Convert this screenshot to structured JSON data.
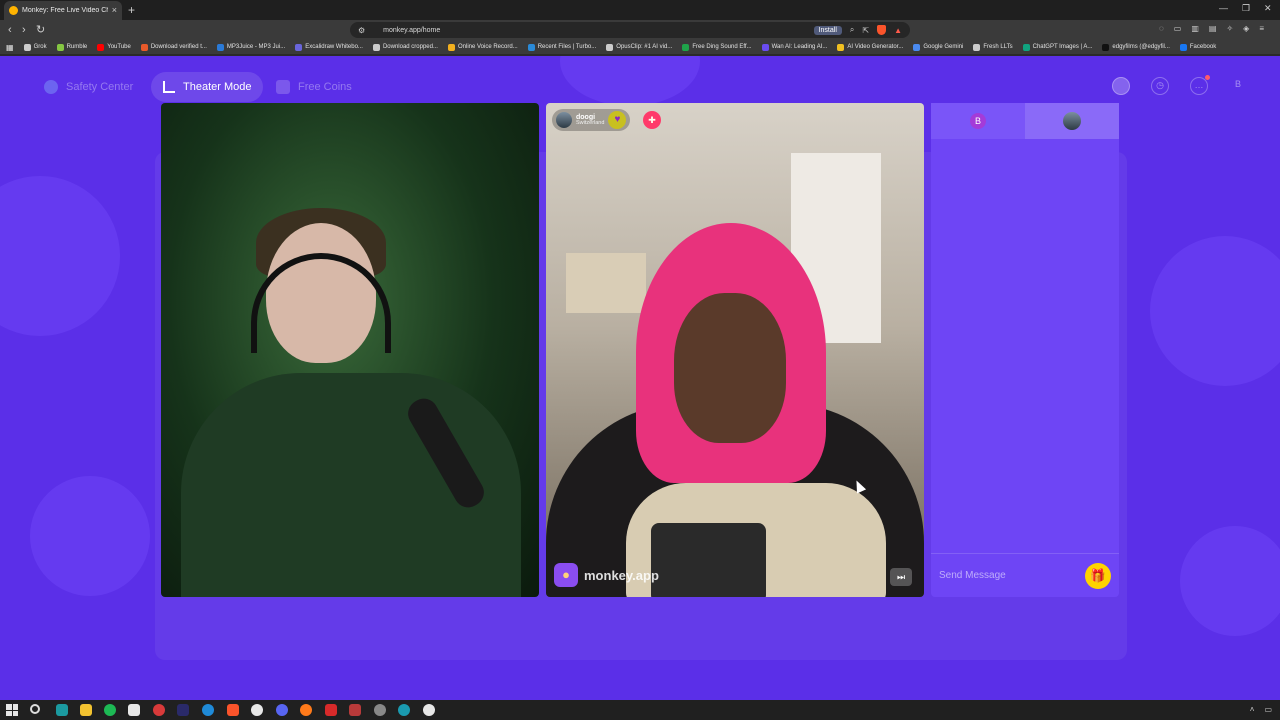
{
  "browser": {
    "tab_title": "Monkey: Free Live Video Chat",
    "url": "monkey.app/home",
    "install_label": "Install",
    "bookmarks": [
      {
        "label": "Grok",
        "color": "#cccccc"
      },
      {
        "label": "Rumble",
        "color": "#85c742"
      },
      {
        "label": "YouTube",
        "color": "#ff0000"
      },
      {
        "label": "Download verified t...",
        "color": "#e85a2a"
      },
      {
        "label": "MP3Juice - MP3 Jui...",
        "color": "#2a7ad8"
      },
      {
        "label": "Excalidraw Whitebo...",
        "color": "#6965db"
      },
      {
        "label": "Download cropped...",
        "color": "#cccccc"
      },
      {
        "label": "Online Voice Record...",
        "color": "#f2b01e"
      },
      {
        "label": "Recent Files | Turbo...",
        "color": "#2a8ad8"
      },
      {
        "label": "OpusClip: #1 AI vid...",
        "color": "#cccccc"
      },
      {
        "label": "Free Ding Sound Eff...",
        "color": "#1fa34a"
      },
      {
        "label": "Wan AI: Leading AI...",
        "color": "#6a4cf0"
      },
      {
        "label": "AI Video Generator...",
        "color": "#f0c020"
      },
      {
        "label": "Google Gemini",
        "color": "#4a8af0"
      },
      {
        "label": "Fresh LLTs",
        "color": "#cccccc"
      },
      {
        "label": "ChatGPT Images | A...",
        "color": "#10a37f"
      },
      {
        "label": "edgyfilms (@edgyfil...",
        "color": "#111111"
      },
      {
        "label": "Facebook",
        "color": "#1877f2"
      }
    ]
  },
  "app": {
    "nav": {
      "safety_center": "Safety Center",
      "theater_mode": "Theater Mode",
      "free_coins": "Free Coins",
      "profile_initial": "B"
    },
    "remote_user": {
      "name": "doogi",
      "country": "Switzerland"
    },
    "watermark": "monkey.app",
    "chat": {
      "self_initial": "B",
      "placeholder": "Send Message"
    },
    "colors": {
      "background": "#5b2fe8",
      "chat_bg": "#6e45f5",
      "accent_gift": "#ffd400"
    }
  }
}
